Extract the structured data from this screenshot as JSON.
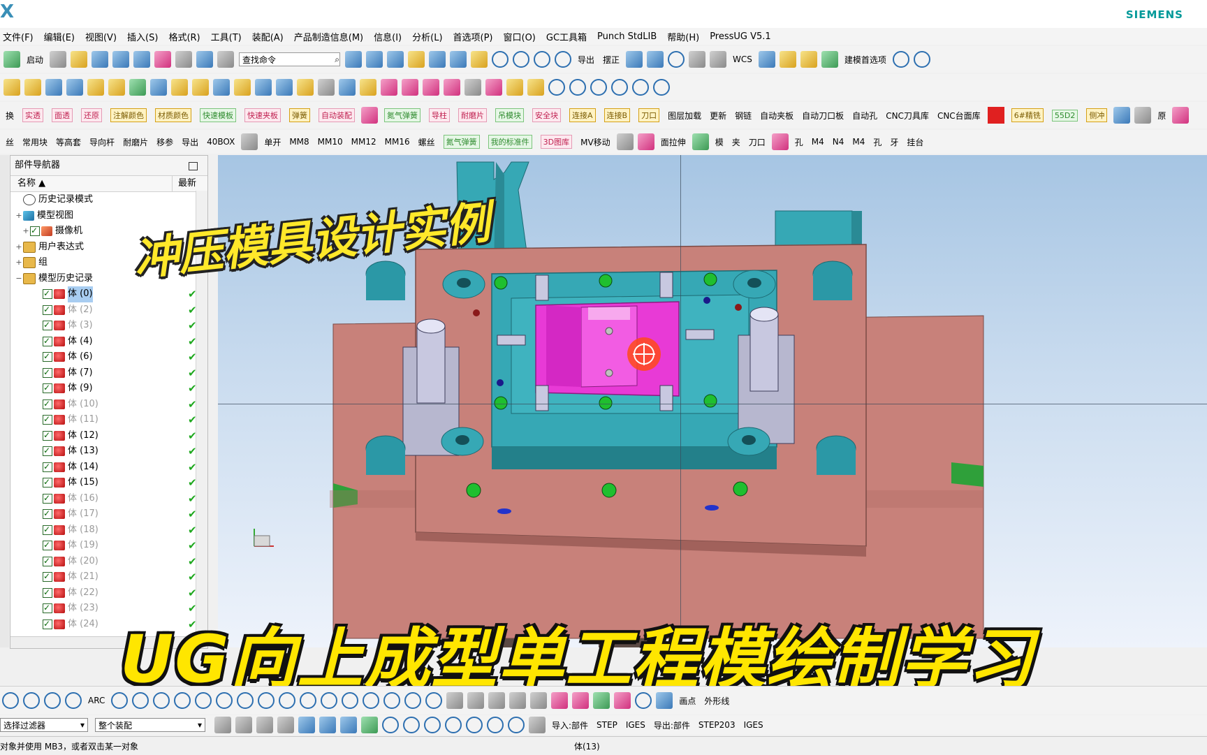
{
  "app": {
    "logo": "X",
    "brand": "SIEMENS"
  },
  "menu": [
    "文件(F)",
    "编辑(E)",
    "视图(V)",
    "插入(S)",
    "格式(R)",
    "工具(T)",
    "装配(A)",
    "产品制造信息(M)",
    "信息(I)",
    "分析(L)",
    "首选项(P)",
    "窗口(O)",
    "GC工具箱",
    "Punch StdLIB",
    "帮助(H)",
    "PressUG V5.1"
  ],
  "toolbar": {
    "start_label": "启动",
    "search_placeholder": "查找命令",
    "export_label": "导出",
    "straighten_label": "摆正",
    "wcs_label": "WCS",
    "model_prefs_label": "建模首选项",
    "row3_labels": [
      "换",
      "实透",
      "面透",
      "还原",
      "注解颜色",
      "材质颜色",
      "快速模板",
      "快速夹板",
      "弹簧",
      "自动装配",
      "氮气弹簧",
      "导柱",
      "耐磨片",
      "吊模块",
      "安全块",
      "连接A",
      "连接B",
      "刀口",
      "图层加载",
      "更新",
      "钢链",
      "自动夹板",
      "自动刀口板",
      "自动孔",
      "CNC刀具库",
      "CNC台面库",
      "6#精铣",
      "55D2",
      "侧冲",
      "原"
    ],
    "row4_labels": [
      "丝",
      "常用块",
      "等高套",
      "导向杆",
      "耐磨片",
      "移参",
      "导出",
      "40BOX",
      "单开",
      "MM8",
      "MM10",
      "MM12",
      "MM16",
      "螺丝",
      "氮气弹簧",
      "我的标准件",
      "3D图库",
      "MV移动",
      "面拉伸",
      "模",
      "夹",
      "刀口",
      "孔",
      "M4",
      "N4",
      "M4",
      "孔",
      "牙",
      "挂台"
    ]
  },
  "navigator": {
    "title": "部件导航器",
    "col_name": "名称",
    "col_latest": "最新",
    "top_items": [
      {
        "label": "历史记录模式",
        "icon": "clock-icon"
      },
      {
        "label": "模型视图",
        "icon": "model-view-icon"
      },
      {
        "label": "摄像机",
        "icon": "camera-icon"
      },
      {
        "label": "用户表达式",
        "icon": "folder-icon"
      },
      {
        "label": "组",
        "icon": "folder-icon"
      },
      {
        "label": "模型历史记录",
        "icon": "folder-icon"
      }
    ],
    "bodies": [
      {
        "label": "体 (0)",
        "dim": false,
        "selected": true
      },
      {
        "label": "体 (2)",
        "dim": true
      },
      {
        "label": "体 (3)",
        "dim": true
      },
      {
        "label": "体 (4)",
        "dim": false
      },
      {
        "label": "体 (6)",
        "dim": false
      },
      {
        "label": "体 (7)",
        "dim": false
      },
      {
        "label": "体 (9)",
        "dim": false
      },
      {
        "label": "体 (10)",
        "dim": true
      },
      {
        "label": "体 (11)",
        "dim": true
      },
      {
        "label": "体 (12)",
        "dim": false
      },
      {
        "label": "体 (13)",
        "dim": false
      },
      {
        "label": "体 (14)",
        "dim": false
      },
      {
        "label": "体 (15)",
        "dim": false
      },
      {
        "label": "体 (16)",
        "dim": true
      },
      {
        "label": "体 (17)",
        "dim": true
      },
      {
        "label": "体 (18)",
        "dim": true
      },
      {
        "label": "体 (19)",
        "dim": true
      },
      {
        "label": "体 (20)",
        "dim": true
      },
      {
        "label": "体 (21)",
        "dim": true
      },
      {
        "label": "体 (22)",
        "dim": true
      },
      {
        "label": "体 (23)",
        "dim": true
      },
      {
        "label": "体 (24)",
        "dim": true
      }
    ]
  },
  "overlay": {
    "caption_top": "冲压模具设计实例",
    "caption_bottom": "UG向上成型单工程模绘制学习"
  },
  "bottom_toolbar": {
    "labels": [
      "ARC",
      "画点",
      "外形线"
    ]
  },
  "filterbar": {
    "filter_value": "选择过滤器",
    "assembly_value": "整个装配",
    "import_label": "导入:部件",
    "step": "STEP",
    "iges": "IGES",
    "export_label": "导出:部件",
    "step203": "STEP203",
    "iges2": "IGES"
  },
  "status": {
    "message": "对象并使用 MB3，或者双击某一对象",
    "selection": "体(13)"
  },
  "colors": {
    "die_pink": "#c8817a",
    "die_teal": "#36a8b5",
    "part_magenta": "#e83ad6",
    "caption_yellow": "#ffe600",
    "red_swatch": "#e02020"
  }
}
